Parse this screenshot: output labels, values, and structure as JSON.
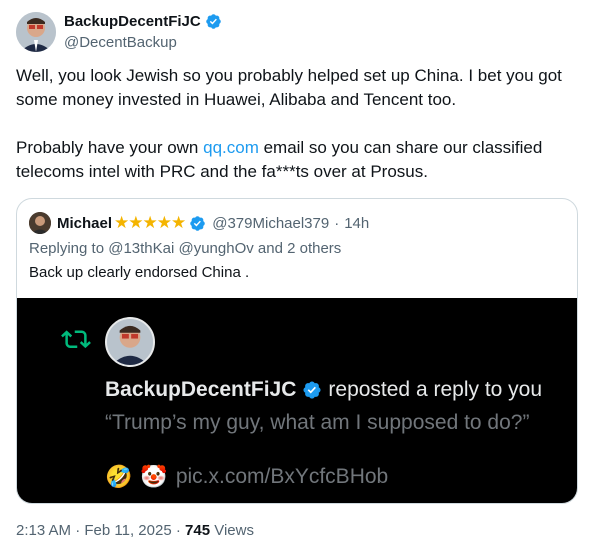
{
  "author": {
    "display_name": "BackupDecentFiJC",
    "handle": "@DecentBackup"
  },
  "tweet": {
    "text_part1": "Well, you look Jewish so you probably helped set up China. I bet you got some money invested in Huawei, Alibaba and Tencent too.\n\nProbably have your own ",
    "link_text": "qq.com",
    "text_part2": " email so you can share our classified telecoms intel with PRC and the fa***ts over at Prosus."
  },
  "quoted": {
    "display_name": "Michael",
    "stars": "★★★★★",
    "handle": "@379Michael379",
    "separator": "·",
    "time": "14h",
    "replying_to": "Replying to @13thKai @yunghOv and 2 others",
    "text": "Back up clearly endorsed China .",
    "media": {
      "name": "BackupDecentFiJC",
      "action": "reposted a reply to you",
      "quote": "“Trump’s my guy, what am I supposed to do?”",
      "emoji1": "🤣",
      "emoji2": "🤡",
      "link": "pic.x.com/BxYcfcBHob"
    }
  },
  "meta": {
    "time": "2:13 AM",
    "separator": "·",
    "date": "Feb 11, 2025",
    "views_count": "745",
    "views_label": "Views"
  },
  "colors": {
    "accent": "#1d9bf0",
    "verified": "#1d9bf0",
    "repost_green": "#00ba7c",
    "star": "#f4b400"
  }
}
